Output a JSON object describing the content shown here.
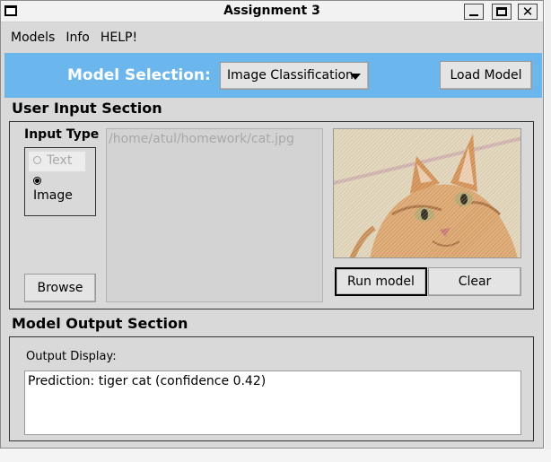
{
  "window": {
    "title": "Assignment 3"
  },
  "menu": [
    "Models",
    "Info",
    "HELP!"
  ],
  "model_selection": {
    "label": "Model Selection:",
    "selected": "Image Classification",
    "load_button": "Load Model"
  },
  "input_section": {
    "title": "User Input Section",
    "input_type_label": "Input Type",
    "radio_text": "Text",
    "radio_image": "Image",
    "selected_input_type": "Image",
    "file_path": "/home/atul/homework/cat.jpg",
    "browse_button": "Browse",
    "run_button": "Run model",
    "clear_button": "Clear"
  },
  "output_section": {
    "title": "Model Output Section",
    "display_label": "Output Display:",
    "prediction_text": "Prediction: tiger cat (confidence 0.42)"
  },
  "colors": {
    "accent": "#6cb6ee"
  }
}
